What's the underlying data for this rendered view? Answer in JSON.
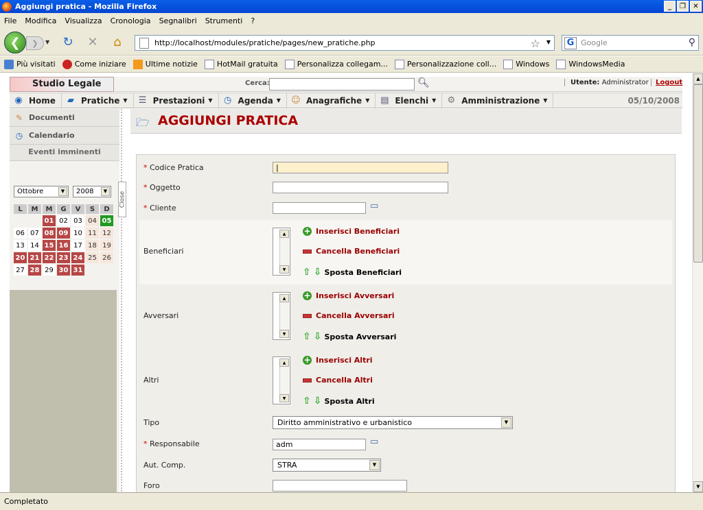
{
  "window": {
    "title": "Aggiungi pratica - Mozilla Firefox"
  },
  "menubar": {
    "items": [
      "File",
      "Modifica",
      "Visualizza",
      "Cronologia",
      "Segnalibri",
      "Strumenti",
      "?"
    ]
  },
  "urlbar": {
    "url": "http://localhost/modules/pratiche/pages/new_pratiche.php"
  },
  "searchbar": {
    "placeholder": "Google"
  },
  "bookmarks": [
    "Più visitati",
    "Come iniziare",
    "Ultime notizie",
    "HotMail gratuita",
    "Personalizza collegam...",
    "Personalizzazione coll...",
    "Windows",
    "WindowsMedia"
  ],
  "status": {
    "text": "Completato"
  },
  "app": {
    "logo": "Studio Legale",
    "search_label": "Cerca:",
    "user_label": "Utente:",
    "user_name": "Administrator",
    "logout": "Logout",
    "date": "05/10/2008",
    "nav": [
      "Home",
      "Pratiche",
      "Prestazioni",
      "Agenda",
      "Anagrafiche",
      "Elenchi",
      "Amministrazione"
    ]
  },
  "sidebar": {
    "documenti": "Documenti",
    "calendario": "Calendario",
    "eventi": "Eventi imminenti",
    "month": "Ottobre",
    "year": "2008",
    "close": "Close",
    "weekdays": [
      "L",
      "M",
      "M",
      "G",
      "V",
      "S",
      "D"
    ],
    "weeks": [
      [
        "",
        "",
        "01",
        "02",
        "03",
        "04",
        "05"
      ],
      [
        "06",
        "07",
        "08",
        "09",
        "10",
        "11",
        "12"
      ],
      [
        "13",
        "14",
        "15",
        "16",
        "17",
        "18",
        "19"
      ],
      [
        "20",
        "21",
        "22",
        "23",
        "24",
        "25",
        "26"
      ],
      [
        "27",
        "28",
        "29",
        "30",
        "31",
        "",
        ""
      ]
    ]
  },
  "page": {
    "title": "AGGIUNGI PRATICA"
  },
  "form": {
    "required_mark": "*",
    "codice_label": "Codice Pratica",
    "codice_value": "",
    "oggetto_label": "Oggetto",
    "cliente_label": "Cliente",
    "beneficiari_label": "Beneficiari",
    "ins_beneficiari": "Inserisci Beneficiari",
    "canc_beneficiari": "Cancella Beneficiari",
    "sposta_beneficiari": "Sposta Beneficiari",
    "avversari_label": "Avversari",
    "ins_avversari": "Inserisci Avversari",
    "canc_avversari": "Cancella Avversari",
    "sposta_avversari": "Sposta Avversari",
    "altri_label": "Altri",
    "ins_altri": "Inserisci Altri",
    "canc_altri": "Cancella Altri",
    "sposta_altri": "Sposta Altri",
    "tipo_label": "Tipo",
    "tipo_value": "Diritto amministrativo e urbanistico",
    "responsabile_label": "Responsabile",
    "responsabile_value": "adm",
    "autcomp_label": "Aut. Comp.",
    "autcomp_value": "STRA",
    "foro_label": "Foro"
  }
}
